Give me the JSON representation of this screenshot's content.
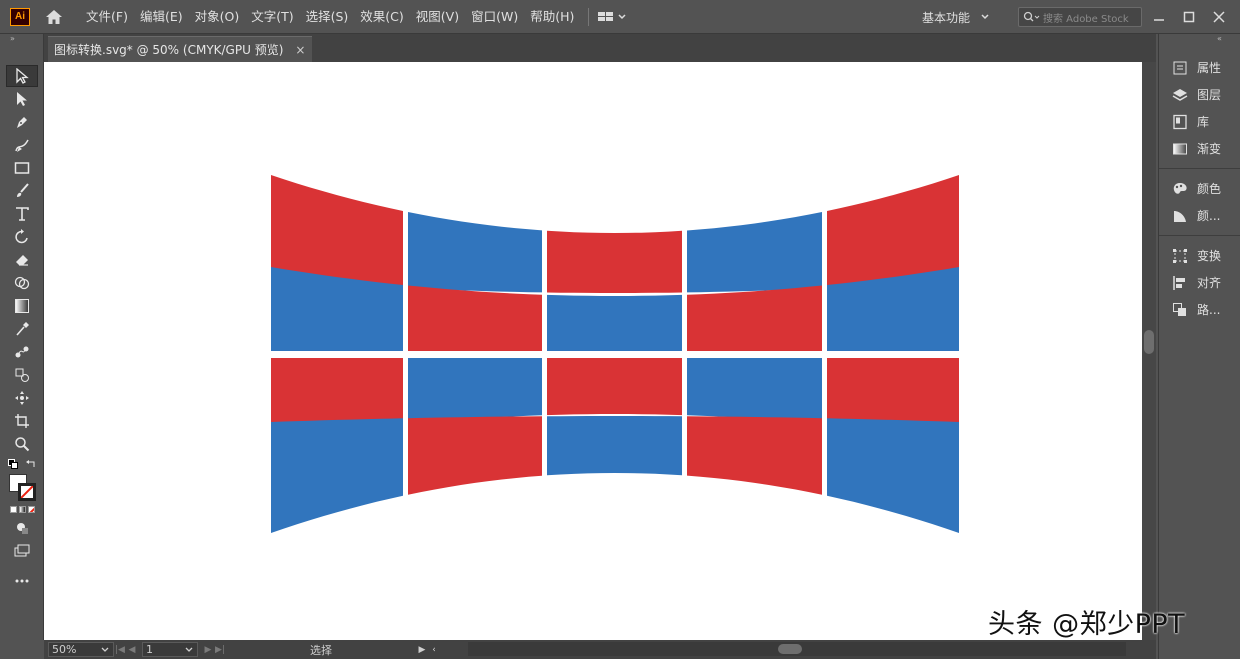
{
  "app": {
    "logo": "Ai"
  },
  "menu": [
    "文件(F)",
    "编辑(E)",
    "对象(O)",
    "文字(T)",
    "选择(S)",
    "效果(C)",
    "视图(V)",
    "窗口(W)",
    "帮助(H)"
  ],
  "workspace": {
    "label": "基本功能"
  },
  "search": {
    "placeholder": "搜索 Adobe Stock"
  },
  "document_tab": {
    "title": "图标转换.svg* @ 50% (CMYK/GPU 预览)",
    "close": "×"
  },
  "right_panel": {
    "group1": [
      {
        "label": "属性",
        "icon": "properties-icon"
      },
      {
        "label": "图层",
        "icon": "layers-icon"
      },
      {
        "label": "库",
        "icon": "libraries-icon"
      },
      {
        "label": "渐变",
        "icon": "gradient-icon"
      }
    ],
    "group2": [
      {
        "label": "颜色",
        "icon": "color-icon"
      },
      {
        "label": "颜...",
        "icon": "color-guide-icon"
      }
    ],
    "group3": [
      {
        "label": "变换",
        "icon": "transform-icon"
      },
      {
        "label": "对齐",
        "icon": "align-icon"
      },
      {
        "label": "路...",
        "icon": "pathfinder-icon"
      }
    ]
  },
  "status": {
    "zoom": "50%",
    "page": "1",
    "mode": "选择"
  },
  "watermark": "头条 @郑少PPT",
  "colors": {
    "red": "#D93335",
    "blue": "#3175BD",
    "ui_bg": "#535353",
    "canvas": "#FFFFFF"
  },
  "artwork": {
    "columns": 5,
    "rows": 4,
    "pattern": [
      [
        "red",
        "blue",
        "red",
        "blue",
        "red"
      ],
      [
        "blue",
        "red",
        "blue",
        "red",
        "blue"
      ],
      [
        "red",
        "blue",
        "red",
        "blue",
        "red"
      ],
      [
        "blue",
        "red",
        "blue",
        "red",
        "blue"
      ]
    ]
  }
}
